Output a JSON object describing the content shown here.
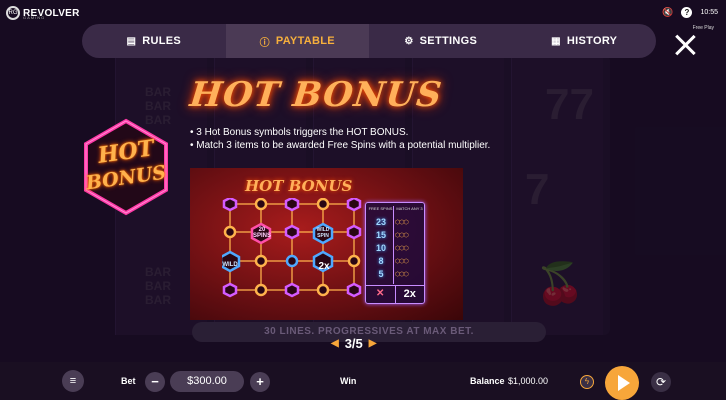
{
  "brand": {
    "name": "REVOLVER",
    "sub": "GAMING",
    "logo": "RG"
  },
  "status": {
    "time": "10:55",
    "mode": "Free Play"
  },
  "tabs": [
    {
      "label": "RULES",
      "icon": "document-icon"
    },
    {
      "label": "PAYTABLE",
      "icon": "info-icon",
      "active": true
    },
    {
      "label": "SETTINGS",
      "icon": "gear-icon"
    },
    {
      "label": "HISTORY",
      "icon": "calendar-icon"
    }
  ],
  "paytable": {
    "title": "HOT BONUS",
    "badge_line1": "HOT",
    "badge_line2": "BONUS",
    "lines": [
      "• 3 Hot Bonus symbols triggers the HOT BONUS.",
      "• Match 3 items to be awarded Free Spins with a potential multiplier."
    ]
  },
  "bonus_image": {
    "title": "HOT BONUS",
    "spins_node": "20 SPINS",
    "wild_spin_node": "WILD SPIN",
    "wild_node": "WILD",
    "mult_node": "2x",
    "col_free_spins": "FREE SPINS",
    "col_match": "MATCH ANY 3",
    "spins_values": [
      "23",
      "15",
      "10",
      "8",
      "5"
    ],
    "cancel_symbol": "✕",
    "multiplier": "2x"
  },
  "footer_note": "30 LINES. PROGRESSIVES AT MAX BET.",
  "pager": {
    "label": "3/5"
  },
  "bottombar": {
    "bet_label": "Bet",
    "bet_value": "$300.00",
    "win_label": "Win",
    "balance_label": "Balance",
    "balance_value": "$1,000.00"
  }
}
